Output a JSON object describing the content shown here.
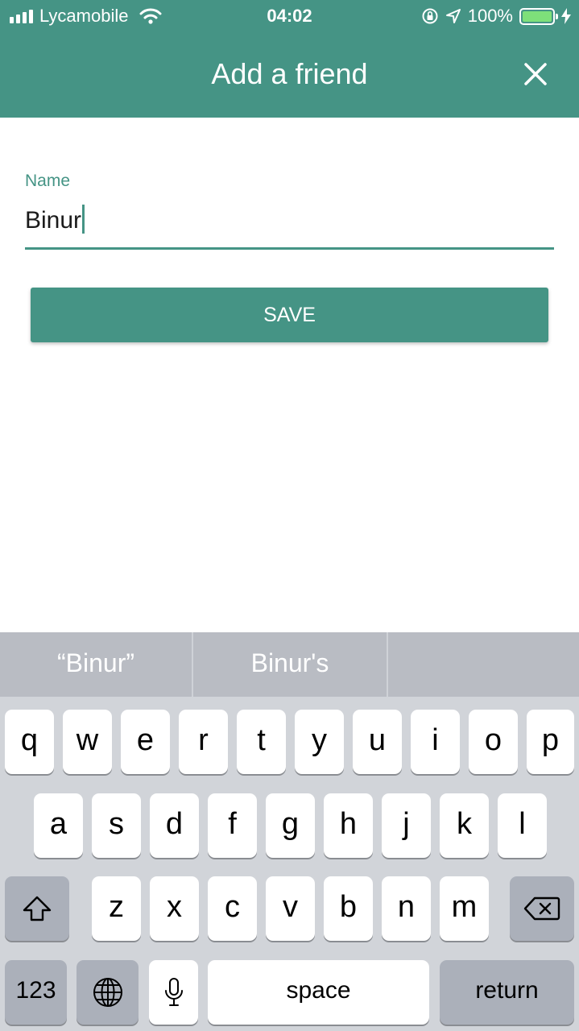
{
  "status_bar": {
    "carrier": "Lycamobile",
    "time": "04:02",
    "battery": "100%",
    "battery_level": 1.0
  },
  "nav": {
    "title": "Add a friend"
  },
  "form": {
    "name_label": "Name",
    "name_value": "Binur",
    "save_label": "SAVE"
  },
  "keyboard": {
    "suggestions": [
      "“Binur”",
      "Binur's",
      ""
    ],
    "row1": [
      "q",
      "w",
      "e",
      "r",
      "t",
      "y",
      "u",
      "i",
      "o",
      "p"
    ],
    "row2": [
      "a",
      "s",
      "d",
      "f",
      "g",
      "h",
      "j",
      "k",
      "l"
    ],
    "row3": [
      "z",
      "x",
      "c",
      "v",
      "b",
      "n",
      "m"
    ],
    "numbers_label": "123",
    "space_label": "space",
    "return_label": "return"
  },
  "colors": {
    "accent": "#459485",
    "keyboard_bg": "#d1d4d9",
    "suggestion_bar": "#b9bcc3",
    "battery_fill": "#7ee07a"
  }
}
